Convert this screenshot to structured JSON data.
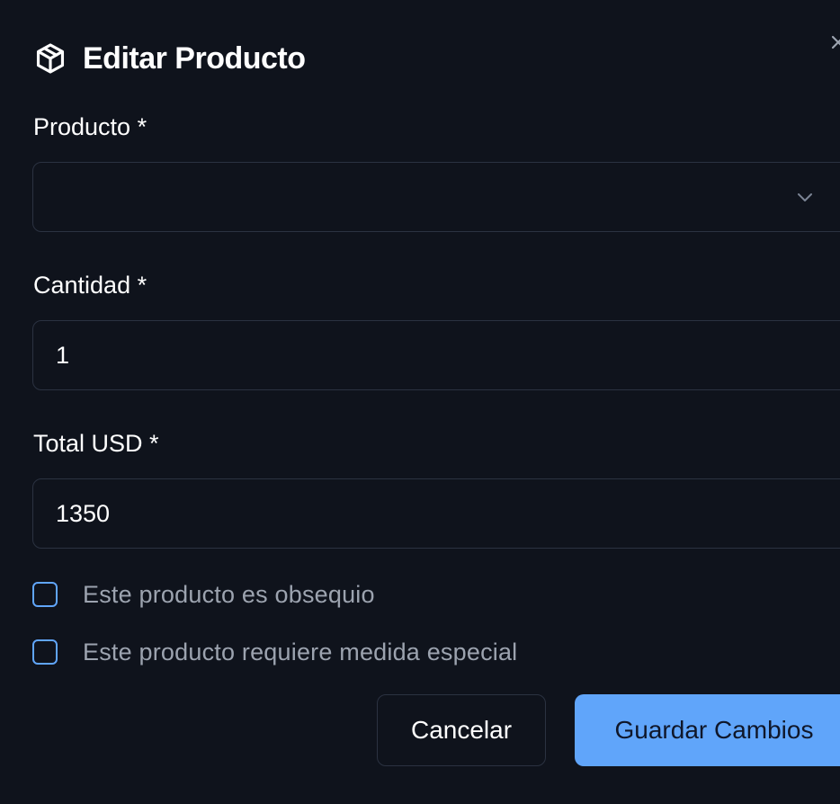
{
  "dialog": {
    "title": "Editar Producto",
    "title_icon": "package-icon",
    "close_icon": "close-icon"
  },
  "form": {
    "product": {
      "label": "Producto *",
      "value": "",
      "icon": "chevron-down-icon"
    },
    "quantity": {
      "label": "Cantidad *",
      "value": "1"
    },
    "total": {
      "label": "Total USD *",
      "value": "1350"
    },
    "checkboxes": [
      {
        "label": "Este producto es obsequio",
        "checked": false
      },
      {
        "label": "Este producto requiere medida especial",
        "checked": false
      }
    ]
  },
  "actions": {
    "cancel_label": "Cancelar",
    "save_label": "Guardar Cambios"
  },
  "colors": {
    "background": "#0f131c",
    "border": "#2b3241",
    "accent": "#60a5fa",
    "muted_text": "#9ca3af"
  }
}
